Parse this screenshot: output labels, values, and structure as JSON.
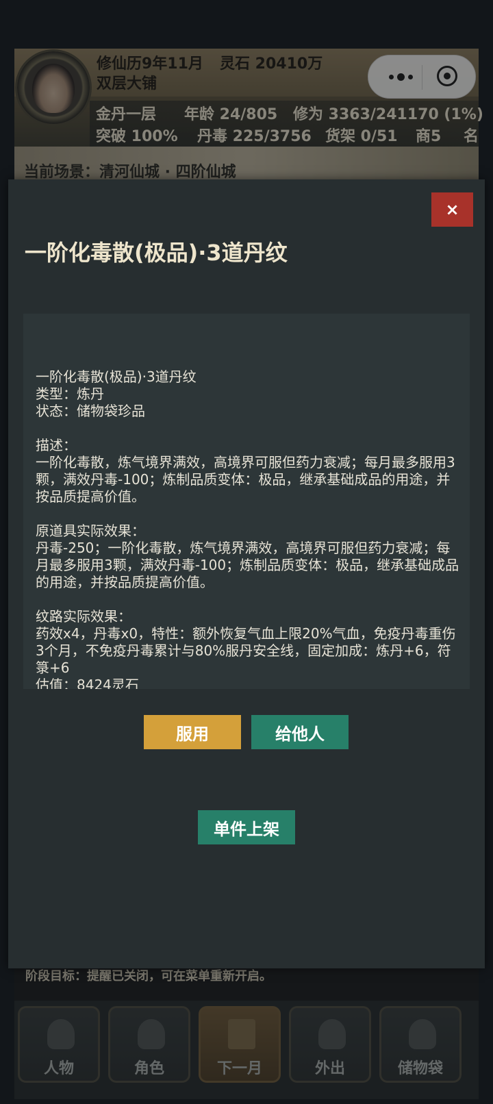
{
  "hud": {
    "calendar": "修仙历9年11月",
    "spirit_stones": "灵石 20410万",
    "shop_name": "双层大铺",
    "realm": "金丹一层",
    "age": "年龄 24/805",
    "cultivation": "修为 3363/241170 (1%)",
    "breakthrough": "突破 100%",
    "pill_poison": "丹毒 225/3756",
    "shelf": "货架 0/51",
    "merchant": "商5",
    "fame_cut": "名"
  },
  "scene": {
    "label": "当前场景：清河仙城 · 四阶仙城"
  },
  "goal": {
    "text": "阶段目标：提醒已关闭，可在菜单重新开启。"
  },
  "nav": {
    "items": [
      {
        "label": "人物",
        "icon": "person-icon"
      },
      {
        "label": "角色",
        "icon": "character-icon"
      },
      {
        "label": "下一月",
        "icon": "flag-icon"
      },
      {
        "label": "外出",
        "icon": "lotus-icon"
      },
      {
        "label": "储物袋",
        "icon": "bag-icon"
      }
    ]
  },
  "modal": {
    "close_label": "×",
    "title": "一阶化毒散(极品)·3道丹纹",
    "detail": {
      "name_line": "一阶化毒散(极品)·3道丹纹",
      "type_line": "类型：炼丹",
      "state_line": "状态：储物袋珍品",
      "desc_label": "描述：",
      "desc_text": "一阶化毒散，炼气境界满效，高境界可服但药力衰减；每月最多服用3颗，满效丹毒-100；炼制品质变体：极品，继承基础成品的用途，并按品质提高价值。",
      "orig_label": "原道具实际效果：",
      "orig_text": "丹毒-250；一阶化毒散，炼气境界满效，高境界可服但药力衰减；每月最多服用3颗，满效丹毒-100；炼制品质变体：极品，继承基础成品的用途，并按品质提高价值。",
      "pattern_label": "纹路实际效果：",
      "pattern_text": "药效x4，丹毒x0，特性：额外恢复气血上限20%气血，免疫丹毒重伤3个月，不免疫丹毒累计与80%服丹安全线，固定加成：炼丹+6，符箓+6",
      "value_line": "估值：8424灵石"
    },
    "use_label": "服用",
    "give_label": "给他人",
    "list_label": "单件上架"
  },
  "colors": {
    "accent_gold": "#d4a03a",
    "accent_green": "#278069",
    "close_red": "#a8322a"
  }
}
